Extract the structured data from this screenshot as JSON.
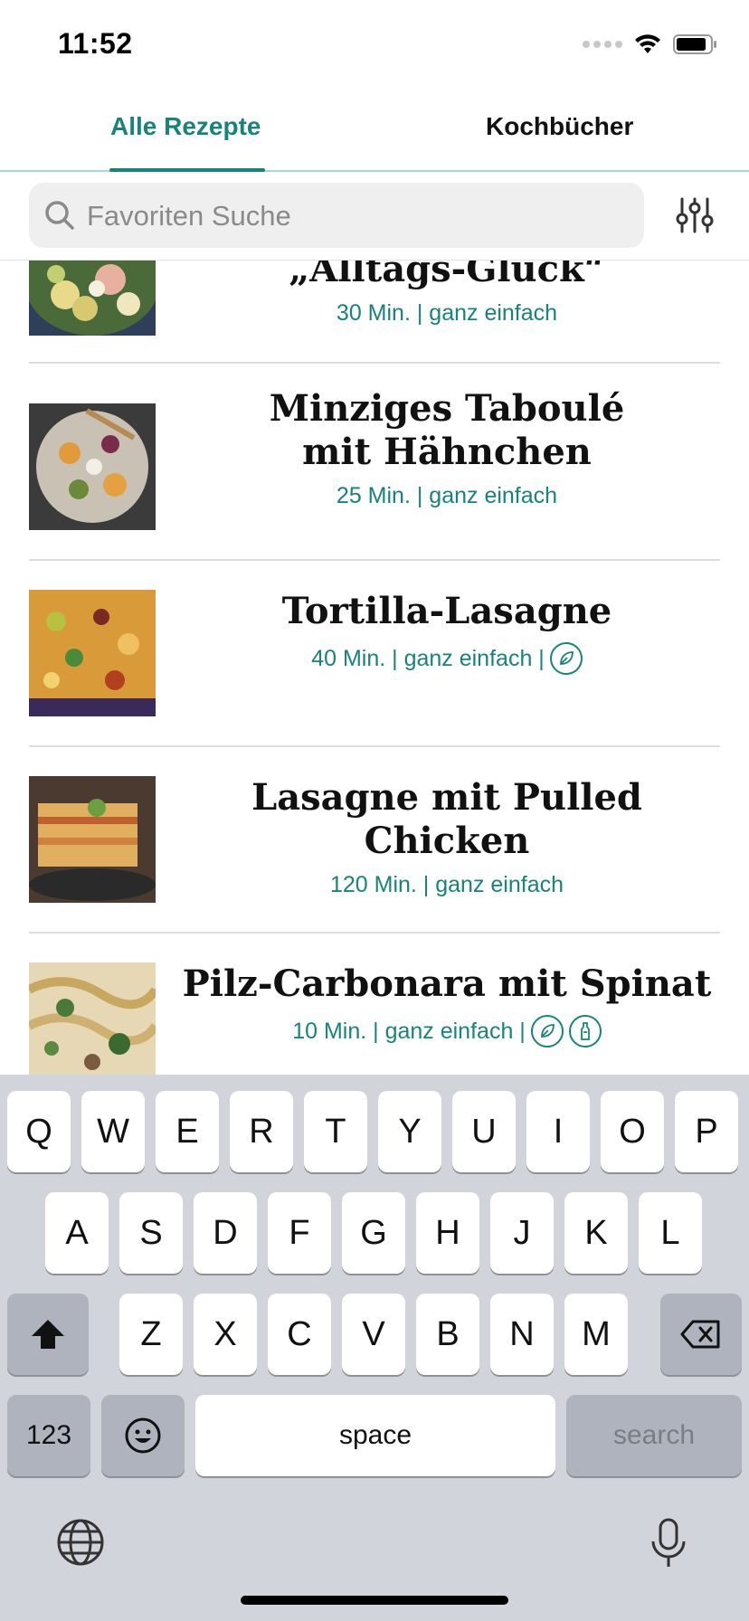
{
  "status_bar": {
    "time": "11:52"
  },
  "tabs": {
    "all_recipes": "Alle Rezepte",
    "cookbooks": "Kochbücher",
    "active": "all_recipes"
  },
  "search": {
    "placeholder": "Favoriten Suche",
    "value": ""
  },
  "recipes": [
    {
      "title": "„Alltags-Glück“",
      "time": "30 Min.",
      "difficulty": "ganz einfach",
      "meta": "30 Min. | ganz einfach",
      "badges": []
    },
    {
      "title": "Minziges Taboulé mit Hähnchen",
      "time": "25 Min.",
      "difficulty": "ganz einfach",
      "meta": "25 Min. | ganz einfach",
      "badges": []
    },
    {
      "title": "Tortilla-Lasagne",
      "time": "40 Min.",
      "difficulty": "ganz einfach",
      "meta": "40 Min. | ganz einfach |",
      "badges": [
        "leaf-icon"
      ]
    },
    {
      "title": "Lasagne mit Pulled Chicken",
      "time": "120 Min.",
      "difficulty": "ganz einfach",
      "meta": "120 Min. | ganz einfach",
      "badges": []
    },
    {
      "title": "Pilz-Carbonara mit Spinat",
      "time": "10 Min.",
      "difficulty": "ganz einfach",
      "meta": "10 Min. | ganz einfach |",
      "badges": [
        "leaf-icon",
        "bottle-icon"
      ]
    }
  ],
  "keyboard": {
    "row1": [
      "Q",
      "W",
      "E",
      "R",
      "T",
      "Y",
      "U",
      "I",
      "O",
      "P"
    ],
    "row2": [
      "A",
      "S",
      "D",
      "F",
      "G",
      "H",
      "J",
      "K",
      "L"
    ],
    "row3": [
      "Z",
      "X",
      "C",
      "V",
      "B",
      "N",
      "M"
    ],
    "numbers_label": "123",
    "space_label": "space",
    "search_label": "search"
  },
  "colors": {
    "accent": "#17837a",
    "keyboard_bg": "#d1d4db"
  }
}
